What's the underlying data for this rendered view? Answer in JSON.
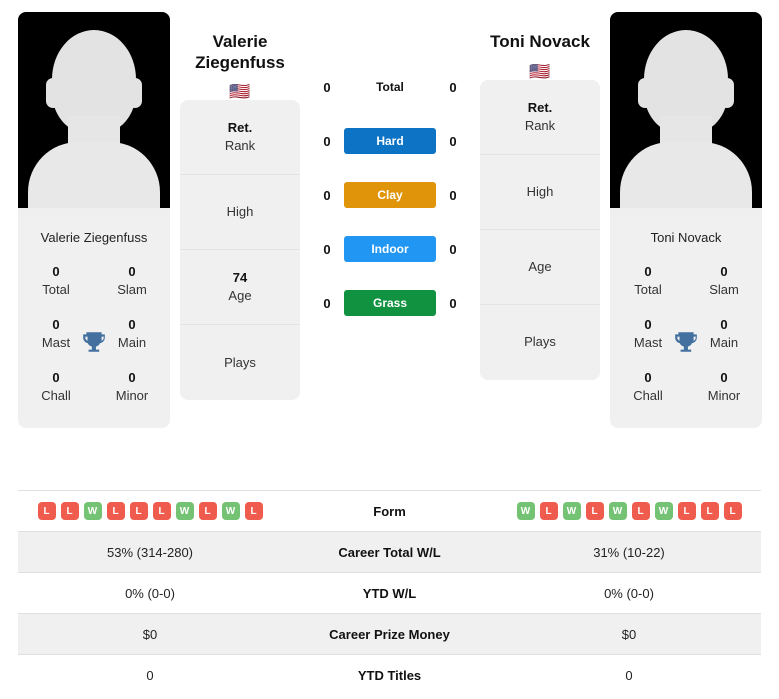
{
  "colors": {
    "hard": "#0d73c4",
    "clay": "#e09409",
    "indoor": "#2196f3",
    "grass": "#109240",
    "win": "#74c274",
    "loss": "#ef5b4c",
    "trophy": "#44709f",
    "card_bg": "#f0f0f0"
  },
  "left_player": {
    "name": "Valerie Ziegenfuss",
    "title_line1": "Valerie",
    "title_line2": "Ziegenfuss",
    "flag": "🇺🇸",
    "flag_name": "usa-flag",
    "titles": [
      {
        "value": "0",
        "label": "Total"
      },
      {
        "value": "0",
        "label": "Slam"
      },
      {
        "value": "0",
        "label": "Mast"
      },
      {
        "value": "0",
        "label": "Main"
      },
      {
        "value": "0",
        "label": "Chall"
      },
      {
        "value": "0",
        "label": "Minor"
      }
    ],
    "info": [
      {
        "value": "Ret.",
        "label": "Rank"
      },
      {
        "value": "",
        "label": "High"
      },
      {
        "value": "74",
        "label": "Age"
      },
      {
        "value": "",
        "label": "Plays"
      }
    ],
    "form": [
      "L",
      "L",
      "W",
      "L",
      "L",
      "L",
      "W",
      "L",
      "W",
      "L"
    ],
    "career_total_wl": "53% (314-280)",
    "ytd_wl": "0% (0-0)",
    "career_prize_money": "$0",
    "ytd_titles": "0",
    "surface_scores": {
      "total": "0",
      "hard": "0",
      "clay": "0",
      "indoor": "0",
      "grass": "0"
    }
  },
  "right_player": {
    "name": "Toni Novack",
    "title_line1": "Toni Novack",
    "title_line2": "",
    "flag": "🇺🇸",
    "flag_name": "usa-flag",
    "titles": [
      {
        "value": "0",
        "label": "Total"
      },
      {
        "value": "0",
        "label": "Slam"
      },
      {
        "value": "0",
        "label": "Mast"
      },
      {
        "value": "0",
        "label": "Main"
      },
      {
        "value": "0",
        "label": "Chall"
      },
      {
        "value": "0",
        "label": "Minor"
      }
    ],
    "info": [
      {
        "value": "Ret.",
        "label": "Rank"
      },
      {
        "value": "",
        "label": "High"
      },
      {
        "value": "",
        "label": "Age"
      },
      {
        "value": "",
        "label": "Plays"
      }
    ],
    "form": [
      "W",
      "L",
      "W",
      "L",
      "W",
      "L",
      "W",
      "L",
      "L",
      "L"
    ],
    "career_total_wl": "31% (10-22)",
    "ytd_wl": "0% (0-0)",
    "career_prize_money": "$0",
    "ytd_titles": "0",
    "surface_scores": {
      "total": "0",
      "hard": "0",
      "clay": "0",
      "indoor": "0",
      "grass": "0"
    }
  },
  "surfaces": [
    {
      "key": "total",
      "label": "Total",
      "style": "plain"
    },
    {
      "key": "hard",
      "label": "Hard",
      "style": "hard"
    },
    {
      "key": "clay",
      "label": "Clay",
      "style": "clay"
    },
    {
      "key": "indoor",
      "label": "Indoor",
      "style": "indoor"
    },
    {
      "key": "grass",
      "label": "Grass",
      "style": "grass"
    }
  ],
  "table_rows": [
    {
      "key": "form",
      "label": "Form",
      "type": "form",
      "shaded": false
    },
    {
      "key": "career_total_wl",
      "label": "Career Total W/L",
      "type": "text",
      "shaded": true
    },
    {
      "key": "ytd_wl",
      "label": "YTD W/L",
      "type": "text",
      "shaded": false
    },
    {
      "key": "career_prize_money",
      "label": "Career Prize Money",
      "type": "text",
      "shaded": true
    },
    {
      "key": "ytd_titles",
      "label": "YTD Titles",
      "type": "text",
      "shaded": false
    }
  ]
}
